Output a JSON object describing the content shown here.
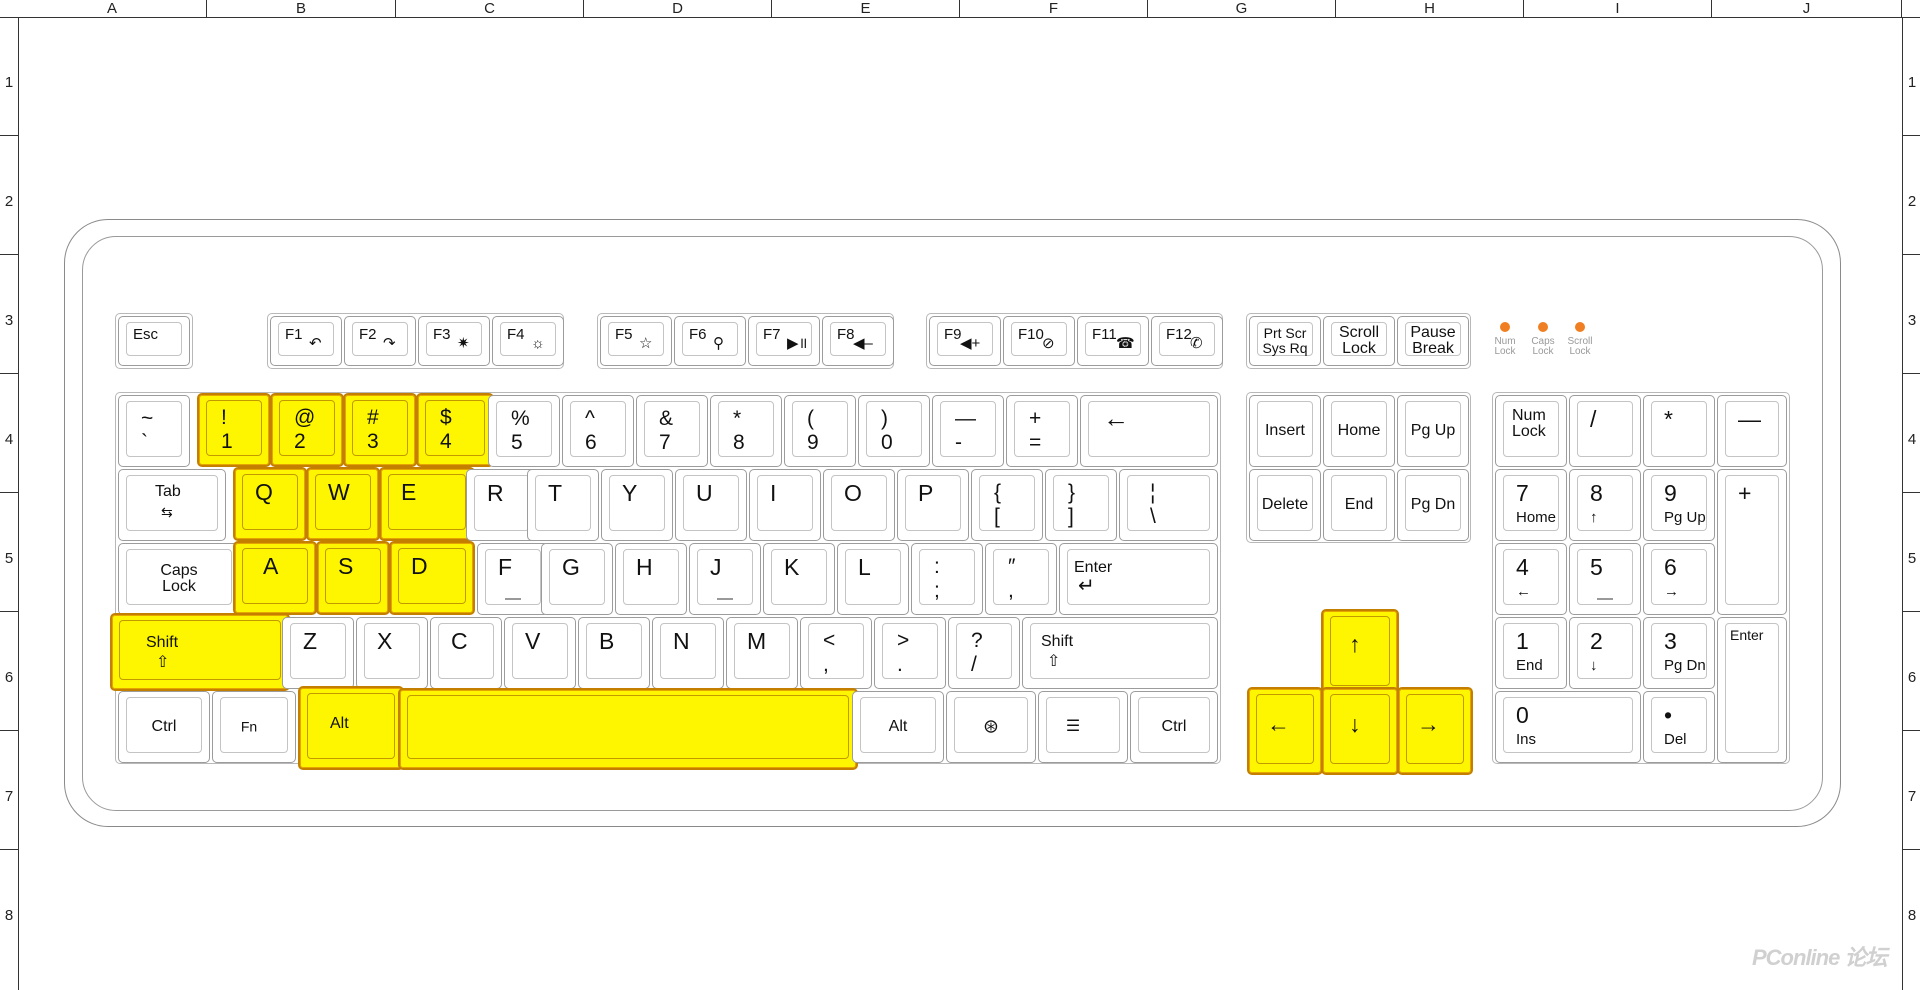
{
  "rulers": {
    "columns": [
      "A",
      "B",
      "C",
      "D",
      "E",
      "F",
      "G",
      "H",
      "I",
      "J"
    ],
    "rows": [
      "1",
      "2",
      "3",
      "4",
      "5",
      "6",
      "7",
      "8"
    ]
  },
  "colors": {
    "highlight": "#fdf600",
    "highlight_border": "#c47f00",
    "led": "#ef7f22"
  },
  "highlighted_keys": [
    "!",
    "@",
    "#",
    "$",
    "Q",
    "W",
    "E",
    "A",
    "S",
    "D",
    "Shift",
    "Alt",
    "Space",
    "Up",
    "Left",
    "Down",
    "Right"
  ],
  "fn_row": {
    "esc": "Esc",
    "f1": "F1",
    "f2": "F2",
    "f3": "F3",
    "f4": "F4",
    "f5": "F5",
    "f6": "F6",
    "f7": "F7",
    "f8": "F8",
    "f9": "F9",
    "f10": "F10",
    "f11": "F11",
    "f12": "F12",
    "prtscr": "Prt Scr\nSys Rq",
    "scroll": "Scroll\nLock",
    "pause": "Pause\nBreak"
  },
  "leds": [
    "Num\nLock",
    "Caps\nLock",
    "Scroll\nLock"
  ],
  "number_row": {
    "tilde_top": "~",
    "tilde_bot": "`",
    "k1_top": "!",
    "k1_bot": "1",
    "k2_top": "@",
    "k2_bot": "2",
    "k3_top": "#",
    "k3_bot": "3",
    "k4_top": "$",
    "k4_bot": "4",
    "k5_top": "%",
    "k5_bot": "5",
    "k6_top": "^",
    "k6_bot": "6",
    "k7_top": "&",
    "k7_bot": "7",
    "k8_top": "*",
    "k8_bot": "8",
    "k9_top": "(",
    "k9_bot": "9",
    "k0_top": ")",
    "k0_bot": "0",
    "minus_top": "—",
    "minus_bot": "-",
    "plus_top": "+",
    "plus_bot": "=",
    "backspace": "←"
  },
  "qwerty_row": {
    "tab": "Tab",
    "tab_icon": "⇆",
    "q": "Q",
    "w": "W",
    "e": "E",
    "r": "R",
    "t": "T",
    "y": "Y",
    "u": "U",
    "i": "I",
    "o": "O",
    "p": "P",
    "lbrace_top": "{",
    "lbrace_bot": "[",
    "rbrace_top": "}",
    "rbrace_bot": "]",
    "pipe_top": "¦",
    "pipe_bot": "\\"
  },
  "home_row": {
    "caps": "Caps\nLock",
    "a": "A",
    "s": "S",
    "d": "D",
    "f": "F",
    "g": "G",
    "h": "H",
    "j": "J",
    "k": "K",
    "l": "L",
    "semi_top": ":",
    "semi_bot": ";",
    "quote_top": "″",
    "quote_bot": ",",
    "enter": "Enter",
    "enter_icon": "↵"
  },
  "shift_row": {
    "lshift": "Shift",
    "shift_icon": "⇧",
    "z": "Z",
    "x": "X",
    "c": "C",
    "v": "V",
    "b": "B",
    "n": "N",
    "m": "M",
    "lt_top": "<",
    "lt_bot": ",",
    "gt_top": ">",
    "gt_bot": ".",
    "q_top": "?",
    "q_bot": "/",
    "rshift": "Shift"
  },
  "bottom_row": {
    "lctrl": "Ctrl",
    "fn": "Fn",
    "lalt": "Alt",
    "space": "",
    "ralt": "Alt",
    "win_icon": "⊛",
    "menu_icon": "☰",
    "rctrl": "Ctrl"
  },
  "nav_cluster": {
    "insert": "Insert",
    "home": "Home",
    "pgup": "Pg Up",
    "delete": "Delete",
    "end": "End",
    "pgdn": "Pg Dn",
    "up": "↑",
    "left": "←",
    "down": "↓",
    "right": "→"
  },
  "numpad": {
    "numlock": "Num\nLock",
    "slash": "/",
    "star": "*",
    "minus": "—",
    "k7": "7",
    "k7_sub": "Home",
    "k8": "8",
    "k8_sub": "↑",
    "k9": "9",
    "k9_sub": "Pg Up",
    "plus": "+",
    "k4": "4",
    "k4_sub": "←",
    "k5": "5",
    "k6": "6",
    "k6_sub": "→",
    "k1": "1",
    "k1_sub": "End",
    "k2": "2",
    "k2_sub": "↓",
    "k3": "3",
    "k3_sub": "Pg Dn",
    "enter": "Enter",
    "k0": "0",
    "k0_sub": "Ins",
    "dot": "•",
    "dot_sub": "Del"
  },
  "watermark": "PConline 论坛"
}
